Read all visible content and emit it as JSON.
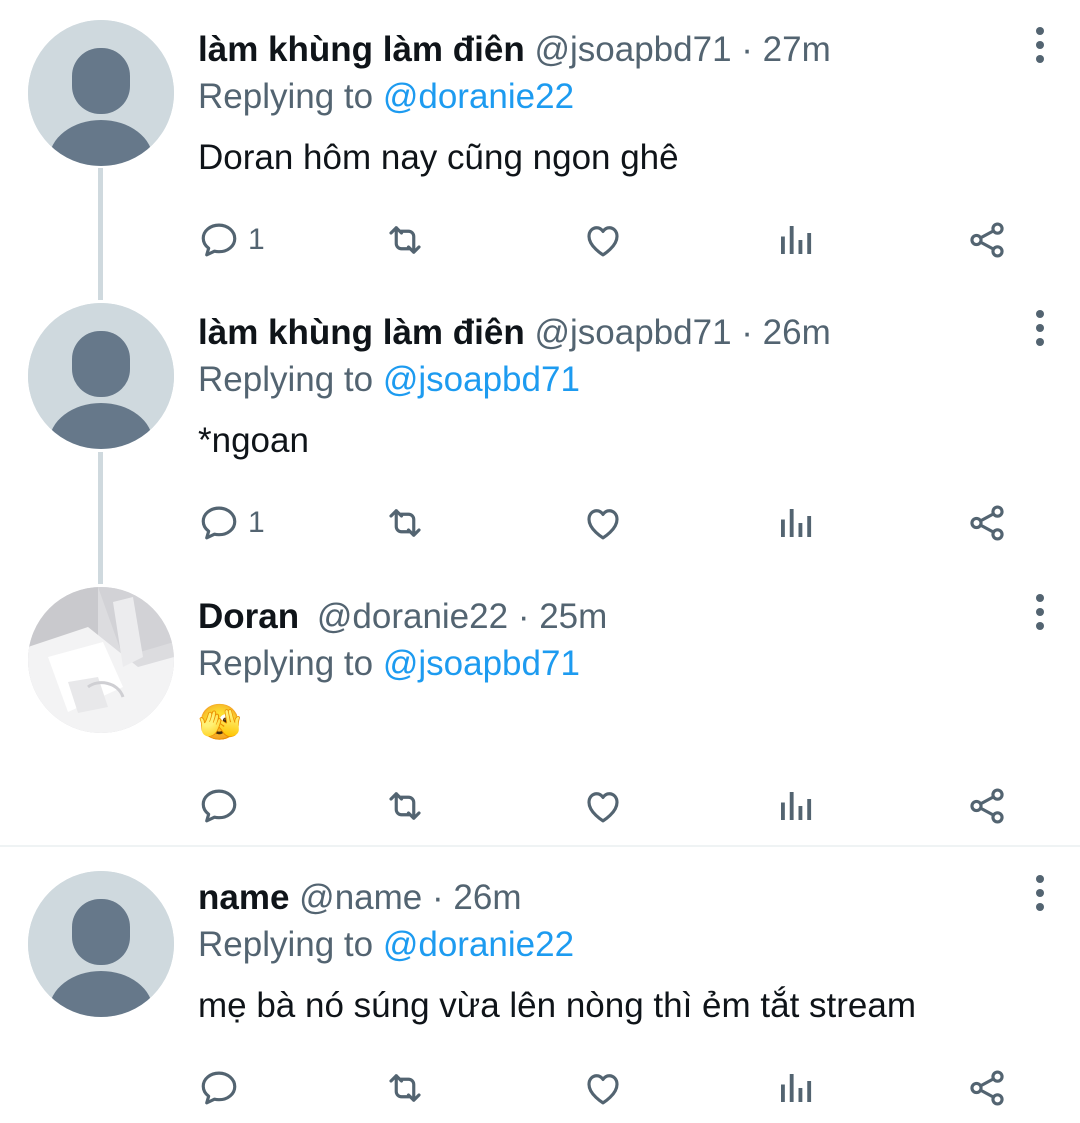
{
  "tweets": [
    {
      "name": "làm khùng làm điên",
      "handle": "@jsoapbd71",
      "dot": "·",
      "time": "27m",
      "replying_label": "Replying to",
      "replying_to": "@doranie22",
      "text": "Doran hôm nay cũng ngon ghê",
      "reply_count": "1",
      "avatar": "default-avatar"
    },
    {
      "name": "làm khùng làm điên",
      "handle": "@jsoapbd71",
      "dot": "·",
      "time": "26m",
      "replying_label": "Replying to",
      "replying_to": "@jsoapbd71",
      "text": "*ngoan",
      "reply_count": "1",
      "avatar": "default-avatar"
    },
    {
      "name": "Doran",
      "handle": "@doranie22",
      "dot": "·",
      "time": "25m",
      "replying_label": "Replying to",
      "replying_to": "@jsoapbd71",
      "text": "🫣",
      "reply_count": "",
      "avatar": "photo-avatar"
    },
    {
      "name": "name",
      "handle": "@name",
      "dot": "·",
      "time": "26m",
      "replying_label": "Replying to",
      "replying_to": "@doranie22",
      "text": "mẹ bà nó súng vừa lên nòng thì ẻm tắt stream",
      "reply_count": "",
      "avatar": "default-avatar"
    }
  ],
  "icons": {
    "reply": "reply-icon",
    "retweet": "retweet-icon",
    "like": "heart-icon",
    "views": "analytics-icon",
    "share": "share-icon",
    "more": "more-options-icon"
  },
  "colors": {
    "link": "#1d9bf0",
    "secondary": "#536471",
    "avatar_bg": "#cfd9de",
    "avatar_fg": "#66788a"
  }
}
